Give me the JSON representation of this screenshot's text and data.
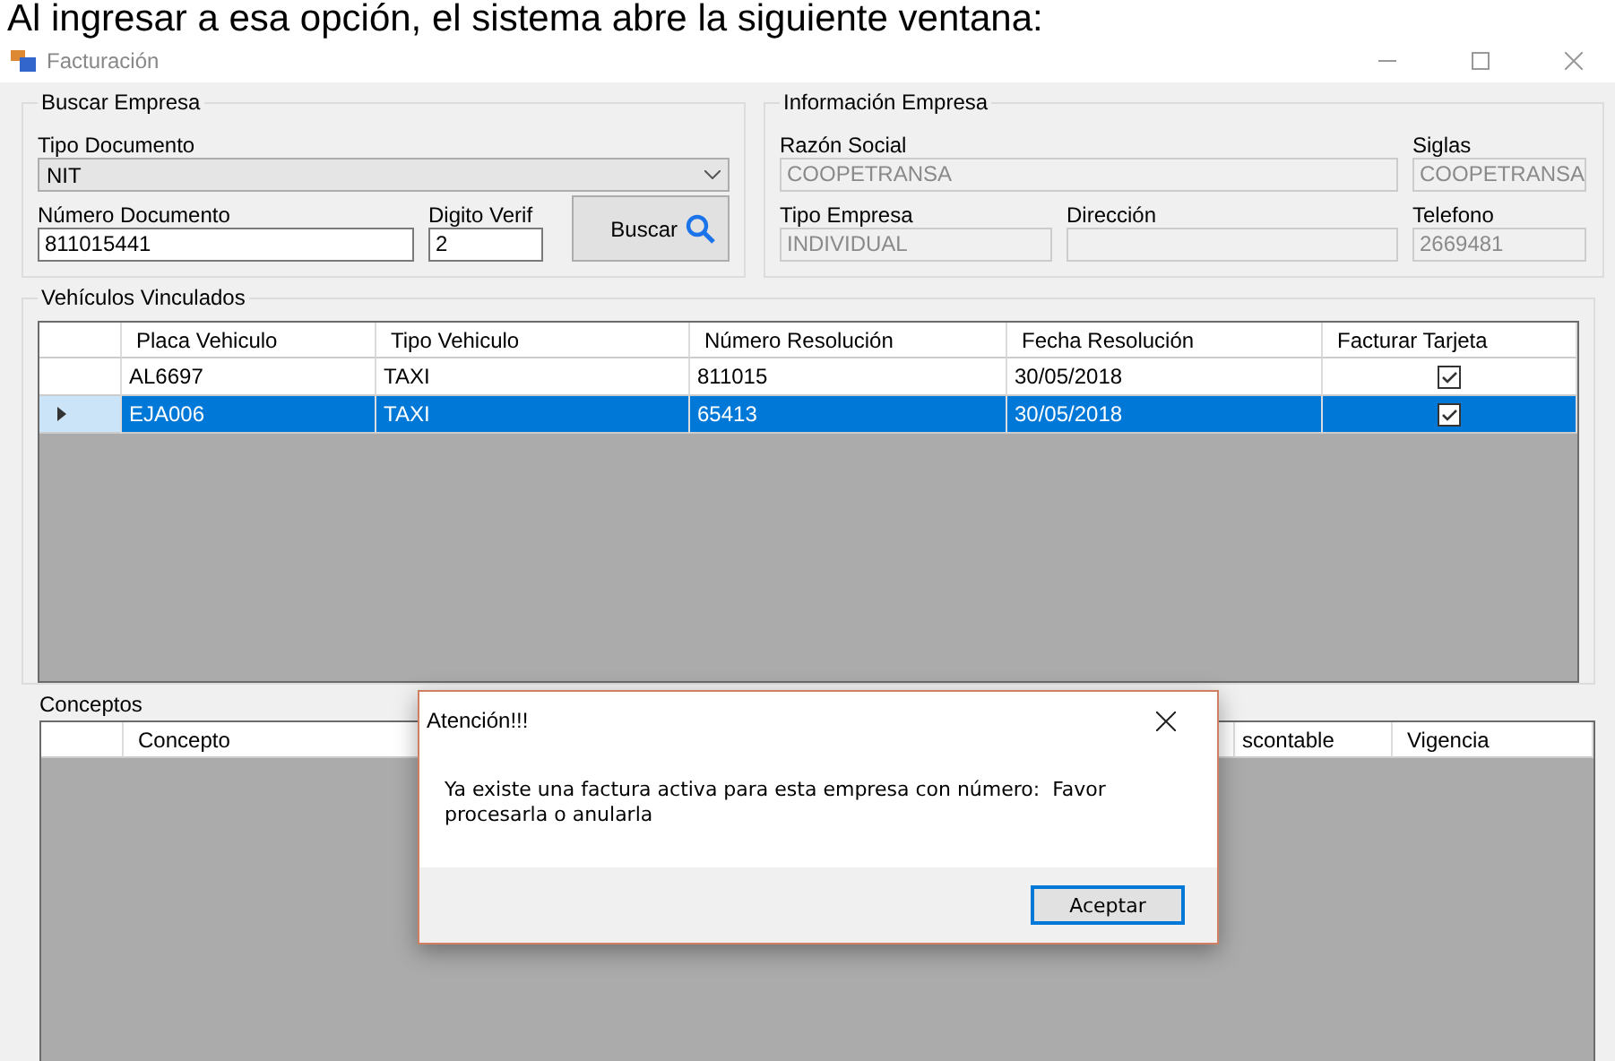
{
  "caption": "Al ingresar a esa opción, el sistema abre la siguiente ventana:",
  "window": {
    "title": "Facturación"
  },
  "buscar_empresa": {
    "title": "Buscar Empresa",
    "tipo_documento": {
      "label": "Tipo Documento",
      "value": "NIT"
    },
    "numero_documento": {
      "label": "Número Documento",
      "value": "811015441"
    },
    "digito_verif": {
      "label": "Digito Verif",
      "value": "2"
    },
    "button": "Buscar"
  },
  "informacion_empresa": {
    "title": "Información Empresa",
    "fields": [
      {
        "label": "Razón Social",
        "value": "COOPETRANSA",
        "disabled": true
      },
      {
        "label": "Siglas",
        "value": "COOPETRANSA",
        "disabled": true
      },
      {
        "label": "Tipo Empresa",
        "value": "INDIVIDUAL",
        "disabled": true
      },
      {
        "label": "Dirección",
        "disabled": true
      },
      {
        "label": "Telefono",
        "value": "2669481",
        "disabled": true
      }
    ]
  },
  "vehiculos": {
    "title": "Vehículos Vinculados",
    "columns": [
      "Placa Vehiculo",
      "Tipo Vehiculo",
      "Número Resolución",
      "Fecha Resolución",
      "Facturar Tarjeta"
    ],
    "rows": [
      {
        "placa": "AL6697",
        "tipo": "TAXI",
        "numero": "811015",
        "fecha": "30/05/2018",
        "facturar": true,
        "selected": false
      },
      {
        "placa": "EJA006",
        "tipo": "TAXI",
        "numero": "65413",
        "fecha": "30/05/2018",
        "facturar": true,
        "selected": true
      }
    ]
  },
  "conceptos": {
    "title": "Conceptos",
    "columns": [
      "Concepto",
      "scontable",
      "Vigencia"
    ]
  },
  "dialog": {
    "title": "Atención!!!",
    "message": "Ya existe una factura activa para esta empresa con número:  Favor procesarla o anularla",
    "button": "Aceptar"
  }
}
